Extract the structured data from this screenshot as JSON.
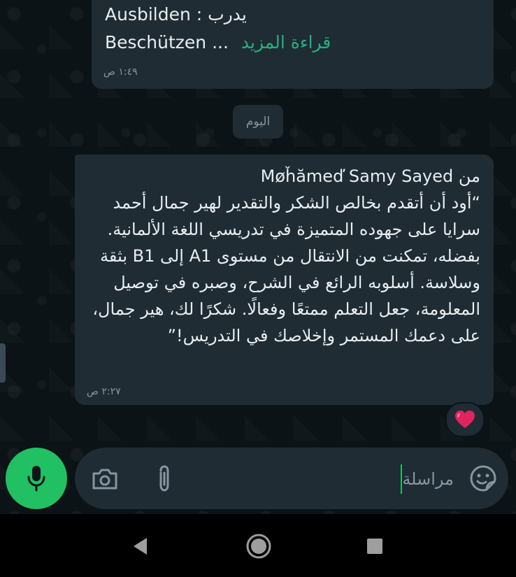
{
  "chat": {
    "prev_message": {
      "line1_latin": "Ausbilden : ",
      "line1_arabic": "يدرب",
      "line2_latin": "Beschützen ... ",
      "read_more": "قراءة المزيد",
      "time": "١:٤٩ ص"
    },
    "date_chip": "اليوم",
    "message": {
      "sender_prefix": "من ",
      "sender_name": "Møȟămeď Samy Sayed",
      "body": "“أود أن أتقدم بخالص الشكر والتقدير لهير جمال أحمد سرايا على جهوده المتميزة في تدريسي اللغة الألمانية. بفضله، تمكنت من الانتقال من مستوى A1 إلى B1 بثقة وسلاسة. أسلوبه الرائع في الشرح، وصبره في توصيل المعلومة، جعل التعلم ممتعًا وفعالًا. شكرًا لك، هير جمال، على دعمك المستمر وإخلاصك في التدريس!”",
      "time": "٢:٢٧ ص",
      "reaction": "❤️"
    }
  },
  "composer": {
    "placeholder": "مراسلة",
    "icons": {
      "mic": "mic-icon",
      "camera": "camera-icon",
      "attach": "paperclip-icon",
      "emoji": "sticker-icon"
    },
    "accent_color": "#21c063"
  },
  "navigation": {
    "back": "back-triangle-icon",
    "home": "home-circle-icon",
    "recent": "recents-square-icon"
  }
}
